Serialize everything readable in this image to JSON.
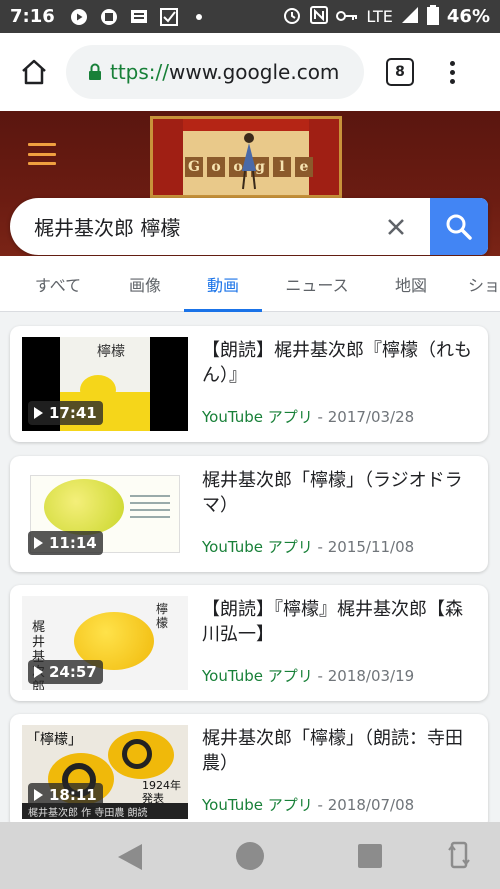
{
  "status_bar": {
    "time": "7:16",
    "network": "LTE",
    "battery": "46%"
  },
  "browser": {
    "url_scheme": "ttps://",
    "url_host": "www.google.com",
    "tab_count": "8"
  },
  "doodle": {
    "letters": [
      "G",
      "o",
      "o",
      "g",
      "l",
      "e"
    ]
  },
  "search": {
    "query": "梶井基次郎 檸檬"
  },
  "tabs": [
    {
      "label": "すべて"
    },
    {
      "label": "画像"
    },
    {
      "label": "動画"
    },
    {
      "label": "ニュース"
    },
    {
      "label": "地図"
    },
    {
      "label": "ショ"
    }
  ],
  "active_tab": "動画",
  "results": [
    {
      "title": "【朗読】梶井基次郎『檸檬（れもん）』",
      "duration": "17:41",
      "source": "YouTube アプリ",
      "date": "- 2017/03/28"
    },
    {
      "title": "梶井基次郎「檸檬」（ラジオドラマ）",
      "duration": "11:14",
      "source": "YouTube アプリ",
      "date": "- 2015/11/08"
    },
    {
      "title": "【朗読】『檸檬』梶井基次郎【森川弘一】",
      "duration": "24:57",
      "source": "YouTube アプリ",
      "date": "- 2018/03/19"
    },
    {
      "title": "梶井基次郎「檸檬」（朗読：寺田農）",
      "duration": "18:11",
      "source": "YouTube アプリ",
      "date": "- 2018/07/08"
    }
  ],
  "thumb_text": {
    "t1_kanji": "檸檬",
    "t3_kanji": "梶井基次郎",
    "t3_kanji2": "檸檬",
    "t4_label": "「檸檬」",
    "t4_year": "1924年 発表",
    "t4_bottom": "梶井基次郎 作  寺田農 朗読"
  },
  "colors": {
    "accent": "#1a73e8",
    "search_button": "#4285f4",
    "source_green": "#188038",
    "status_bar": "#3c3c3c",
    "doodle_band": "#5a160f"
  },
  "icons": {
    "status_left": [
      "youtube-icon",
      "news-icon",
      "message-icon",
      "check-box-icon",
      "dot-icon"
    ],
    "status_right": [
      "alarm-icon",
      "nfc-icon",
      "key-icon",
      "signal-icon",
      "battery-icon"
    ]
  }
}
